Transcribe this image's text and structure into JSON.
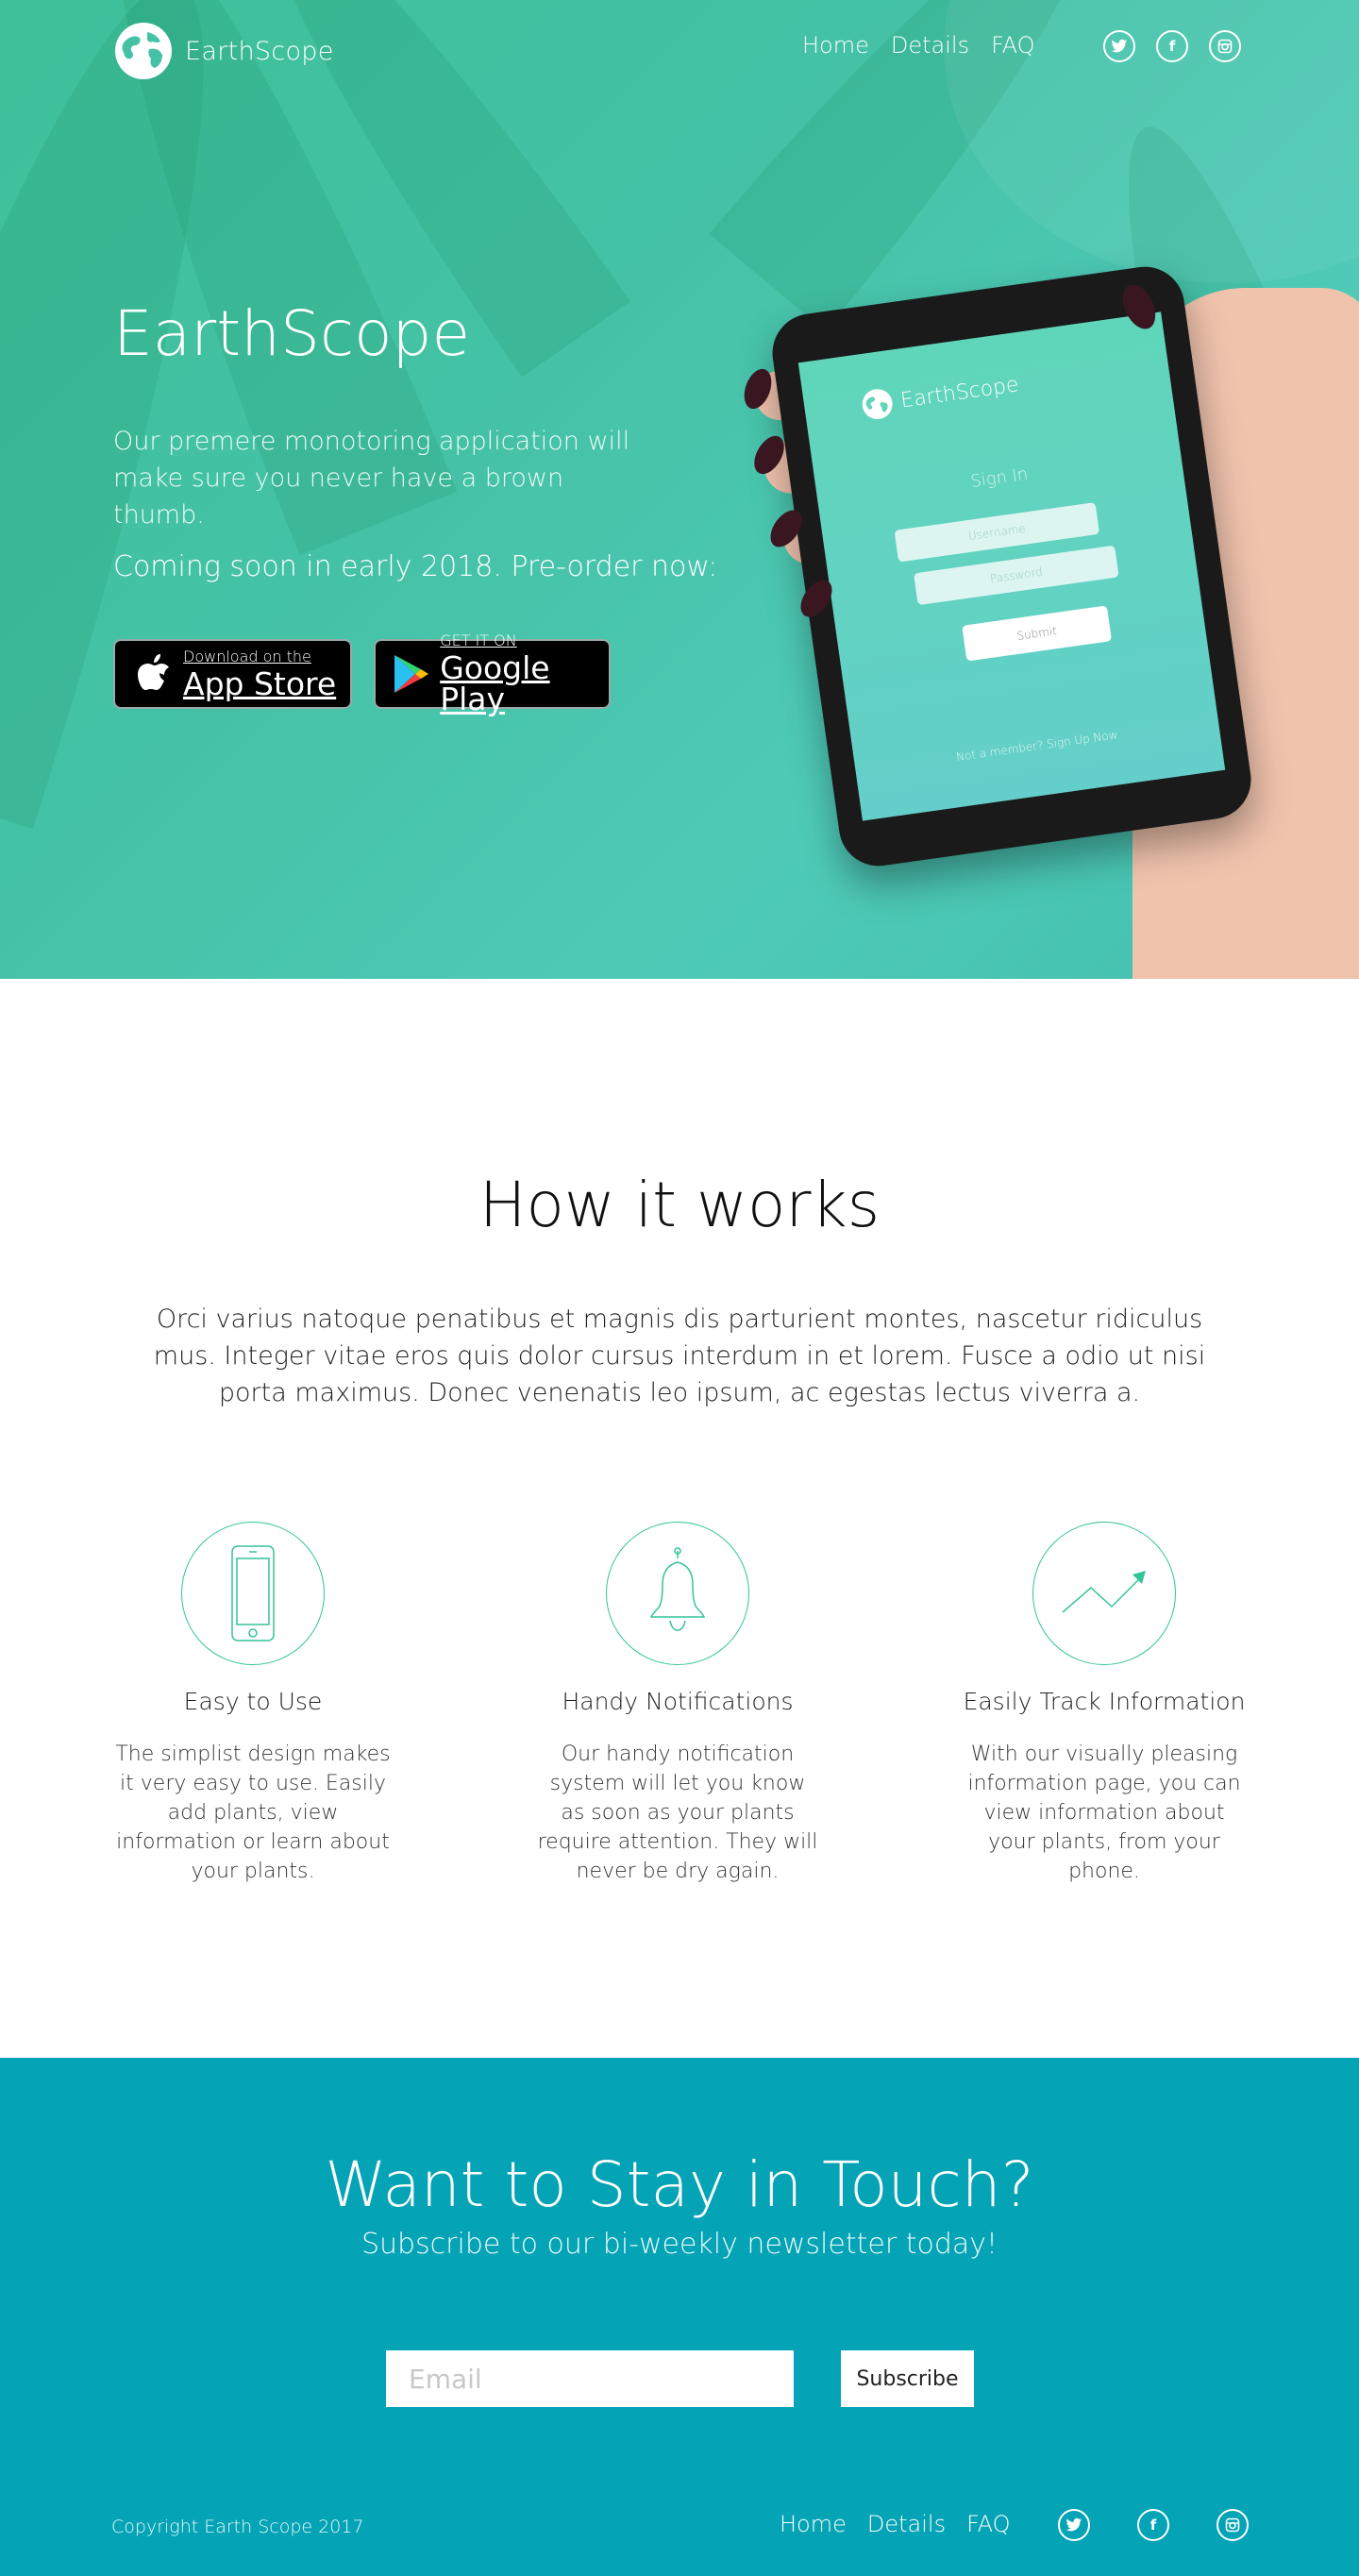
{
  "brand": "EarthScope",
  "nav": {
    "links": [
      "Home",
      "Details",
      "FAQ"
    ]
  },
  "socials": {
    "twitter": "twitter-icon",
    "facebook": "facebook-icon",
    "instagram": "instagram-icon"
  },
  "hero": {
    "title": "EarthScope",
    "tagline": "Our premere monotoring application will make sure you never have a brown thumb.",
    "soon": "Coming soon in early 2018. Pre-order now:",
    "appstore": {
      "small": "Download on the",
      "big": "App Store"
    },
    "googleplay": {
      "small": "GET IT ON",
      "big": "Google Play"
    }
  },
  "phone_screen": {
    "brand": "EarthScope",
    "sign_in": "Sign In",
    "username_placeholder": "Username",
    "password_placeholder": "Password",
    "submit": "Submit",
    "footer": "Not a member?  Sign Up Now"
  },
  "how": {
    "title": "How it works",
    "text": "Orci varius natoque penatibus et magnis dis parturient montes, nascetur ridiculus mus. Integer vitae eros quis dolor cursus interdum in et lorem. Fusce a odio ut nisi porta maximus. Donec venenatis leo ipsum, ac egestas lectus viverra a.",
    "features": [
      {
        "title": "Easy to Use",
        "text": "The simplist design makes it very easy to use. Easily add plants, view information or learn about your plants.",
        "icon": "phone-icon"
      },
      {
        "title": "Handy Notifications",
        "text": "Our handy notification system will let you know as soon as your plants require attention. They will never be dry again.",
        "icon": "bell-icon"
      },
      {
        "title": "Easily Track Information",
        "text": "With our visually pleasing information page, you can view information about your plants, from your phone.",
        "icon": "trend-icon"
      }
    ]
  },
  "newsletter": {
    "title": "Want to Stay in Touch?",
    "subtitle": "Subscribe to our bi-weekly newsletter today!",
    "email_placeholder": "Email",
    "button": "Subscribe"
  },
  "footer": {
    "copyright": "Copyright Earth Scope 2017",
    "links": [
      "Home",
      "Details",
      "FAQ"
    ]
  },
  "colors": {
    "hero": "#45c2a6",
    "accent": "#33c49a",
    "newsletter": "#04a3b5"
  }
}
